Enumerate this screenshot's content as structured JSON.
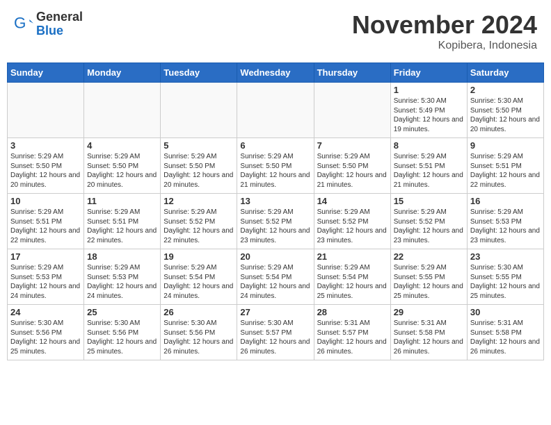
{
  "header": {
    "logo": {
      "general": "General",
      "blue": "Blue"
    },
    "title": "November 2024",
    "location": "Kopibera, Indonesia"
  },
  "days_of_week": [
    "Sunday",
    "Monday",
    "Tuesday",
    "Wednesday",
    "Thursday",
    "Friday",
    "Saturday"
  ],
  "weeks": [
    [
      {
        "day": "",
        "info": ""
      },
      {
        "day": "",
        "info": ""
      },
      {
        "day": "",
        "info": ""
      },
      {
        "day": "",
        "info": ""
      },
      {
        "day": "",
        "info": ""
      },
      {
        "day": "1",
        "info": "Sunrise: 5:30 AM\nSunset: 5:49 PM\nDaylight: 12 hours and 19 minutes."
      },
      {
        "day": "2",
        "info": "Sunrise: 5:30 AM\nSunset: 5:50 PM\nDaylight: 12 hours and 20 minutes."
      }
    ],
    [
      {
        "day": "3",
        "info": "Sunrise: 5:29 AM\nSunset: 5:50 PM\nDaylight: 12 hours and 20 minutes."
      },
      {
        "day": "4",
        "info": "Sunrise: 5:29 AM\nSunset: 5:50 PM\nDaylight: 12 hours and 20 minutes."
      },
      {
        "day": "5",
        "info": "Sunrise: 5:29 AM\nSunset: 5:50 PM\nDaylight: 12 hours and 20 minutes."
      },
      {
        "day": "6",
        "info": "Sunrise: 5:29 AM\nSunset: 5:50 PM\nDaylight: 12 hours and 21 minutes."
      },
      {
        "day": "7",
        "info": "Sunrise: 5:29 AM\nSunset: 5:50 PM\nDaylight: 12 hours and 21 minutes."
      },
      {
        "day": "8",
        "info": "Sunrise: 5:29 AM\nSunset: 5:51 PM\nDaylight: 12 hours and 21 minutes."
      },
      {
        "day": "9",
        "info": "Sunrise: 5:29 AM\nSunset: 5:51 PM\nDaylight: 12 hours and 22 minutes."
      }
    ],
    [
      {
        "day": "10",
        "info": "Sunrise: 5:29 AM\nSunset: 5:51 PM\nDaylight: 12 hours and 22 minutes."
      },
      {
        "day": "11",
        "info": "Sunrise: 5:29 AM\nSunset: 5:51 PM\nDaylight: 12 hours and 22 minutes."
      },
      {
        "day": "12",
        "info": "Sunrise: 5:29 AM\nSunset: 5:52 PM\nDaylight: 12 hours and 22 minutes."
      },
      {
        "day": "13",
        "info": "Sunrise: 5:29 AM\nSunset: 5:52 PM\nDaylight: 12 hours and 23 minutes."
      },
      {
        "day": "14",
        "info": "Sunrise: 5:29 AM\nSunset: 5:52 PM\nDaylight: 12 hours and 23 minutes."
      },
      {
        "day": "15",
        "info": "Sunrise: 5:29 AM\nSunset: 5:52 PM\nDaylight: 12 hours and 23 minutes."
      },
      {
        "day": "16",
        "info": "Sunrise: 5:29 AM\nSunset: 5:53 PM\nDaylight: 12 hours and 23 minutes."
      }
    ],
    [
      {
        "day": "17",
        "info": "Sunrise: 5:29 AM\nSunset: 5:53 PM\nDaylight: 12 hours and 24 minutes."
      },
      {
        "day": "18",
        "info": "Sunrise: 5:29 AM\nSunset: 5:53 PM\nDaylight: 12 hours and 24 minutes."
      },
      {
        "day": "19",
        "info": "Sunrise: 5:29 AM\nSunset: 5:54 PM\nDaylight: 12 hours and 24 minutes."
      },
      {
        "day": "20",
        "info": "Sunrise: 5:29 AM\nSunset: 5:54 PM\nDaylight: 12 hours and 24 minutes."
      },
      {
        "day": "21",
        "info": "Sunrise: 5:29 AM\nSunset: 5:54 PM\nDaylight: 12 hours and 25 minutes."
      },
      {
        "day": "22",
        "info": "Sunrise: 5:29 AM\nSunset: 5:55 PM\nDaylight: 12 hours and 25 minutes."
      },
      {
        "day": "23",
        "info": "Sunrise: 5:30 AM\nSunset: 5:55 PM\nDaylight: 12 hours and 25 minutes."
      }
    ],
    [
      {
        "day": "24",
        "info": "Sunrise: 5:30 AM\nSunset: 5:56 PM\nDaylight: 12 hours and 25 minutes."
      },
      {
        "day": "25",
        "info": "Sunrise: 5:30 AM\nSunset: 5:56 PM\nDaylight: 12 hours and 25 minutes."
      },
      {
        "day": "26",
        "info": "Sunrise: 5:30 AM\nSunset: 5:56 PM\nDaylight: 12 hours and 26 minutes."
      },
      {
        "day": "27",
        "info": "Sunrise: 5:30 AM\nSunset: 5:57 PM\nDaylight: 12 hours and 26 minutes."
      },
      {
        "day": "28",
        "info": "Sunrise: 5:31 AM\nSunset: 5:57 PM\nDaylight: 12 hours and 26 minutes."
      },
      {
        "day": "29",
        "info": "Sunrise: 5:31 AM\nSunset: 5:58 PM\nDaylight: 12 hours and 26 minutes."
      },
      {
        "day": "30",
        "info": "Sunrise: 5:31 AM\nSunset: 5:58 PM\nDaylight: 12 hours and 26 minutes."
      }
    ]
  ]
}
